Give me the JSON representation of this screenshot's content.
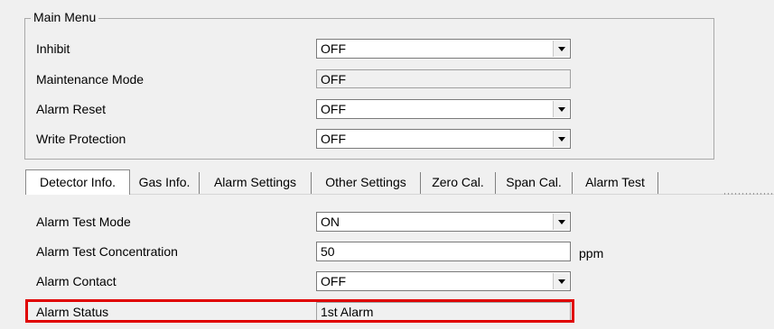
{
  "main_menu": {
    "title": "Main Menu",
    "rows": [
      {
        "label": "Inhibit",
        "value": "OFF"
      },
      {
        "label": "Maintenance Mode",
        "value": "OFF"
      },
      {
        "label": "Alarm Reset",
        "value": "OFF"
      },
      {
        "label": "Write Protection",
        "value": "OFF"
      }
    ]
  },
  "tabs": [
    {
      "label": "Detector Info."
    },
    {
      "label": "Gas Info."
    },
    {
      "label": "Alarm Settings"
    },
    {
      "label": "Other Settings"
    },
    {
      "label": "Zero Cal."
    },
    {
      "label": "Span Cal."
    },
    {
      "label": "Alarm Test"
    }
  ],
  "alarm_test": {
    "rows": [
      {
        "label": "Alarm Test Mode",
        "value": "ON"
      },
      {
        "label": "Alarm Test Concentration",
        "value": "50",
        "unit": "ppm"
      },
      {
        "label": "Alarm Contact",
        "value": "OFF"
      },
      {
        "label": "Alarm Status",
        "value": "1st Alarm"
      }
    ],
    "highlight_color": "#e00000"
  },
  "icons": {
    "dropdown": "chevron-down-icon"
  }
}
